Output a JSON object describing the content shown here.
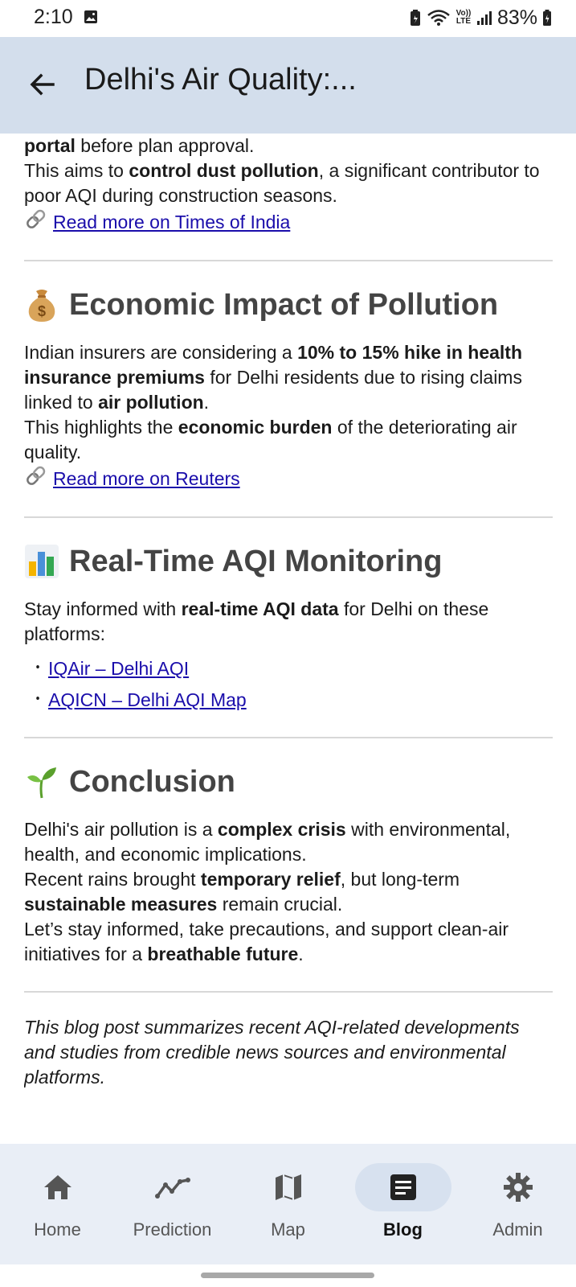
{
  "status_bar": {
    "time": "2:10",
    "battery": "83%",
    "volte_top": "Vo))",
    "volte_bottom": "LTE"
  },
  "app_bar": {
    "title": "Delhi's Air Quality:..."
  },
  "construction": {
    "bold_start": "portal",
    "text_start": " before plan approval.",
    "aims_pre": "This aims to ",
    "aims_bold": "control dust pollution",
    "aims_post": ", a significant contributor to poor AQI during construction seasons.",
    "link": "Read more on Times of India"
  },
  "economic": {
    "emoji": "money-bag-icon",
    "title": "Economic Impact of Pollution",
    "p1_pre": "Indian insurers are considering a ",
    "p1_bold": "10% to 15% hike in health insurance premiums",
    "p1_mid": " for Delhi residents due to rising claims linked to ",
    "p1_bold2": "air pollution",
    "p1_end": ".",
    "p2_pre": "This highlights the ",
    "p2_bold": "economic burden",
    "p2_post": " of the deteriorating air quality.",
    "link": "Read more on Reuters"
  },
  "realtime": {
    "emoji": "bar-chart-icon",
    "title": "Real-Time AQI Monitoring",
    "p_pre": "Stay informed with ",
    "p_bold": "real-time AQI data",
    "p_post": " for Delhi on these platforms:",
    "links": [
      "IQAir – Delhi AQI",
      "AQICN – Delhi AQI Map"
    ]
  },
  "conclusion": {
    "emoji": "seedling-icon",
    "title": "Conclusion",
    "l1_pre": "Delhi's air pollution is a ",
    "l1_bold": "complex crisis",
    "l1_post": " with environmental, health, and economic implications.",
    "l2_pre": "Recent rains brought ",
    "l2_bold": "temporary relief",
    "l2_mid": ", but long-term ",
    "l2_bold2": "sustainable measures",
    "l2_post": " remain crucial.",
    "l3_pre": "Let’s stay informed, take precautions, and support clean-air initiatives for a ",
    "l3_bold": "breathable future",
    "l3_end": "."
  },
  "footnote": "This blog post summarizes recent AQI-related developments and studies from credible news sources and environmental platforms.",
  "nav": {
    "home": "Home",
    "prediction": "Prediction",
    "map": "Map",
    "blog": "Blog",
    "admin": "Admin",
    "active": "Blog"
  }
}
